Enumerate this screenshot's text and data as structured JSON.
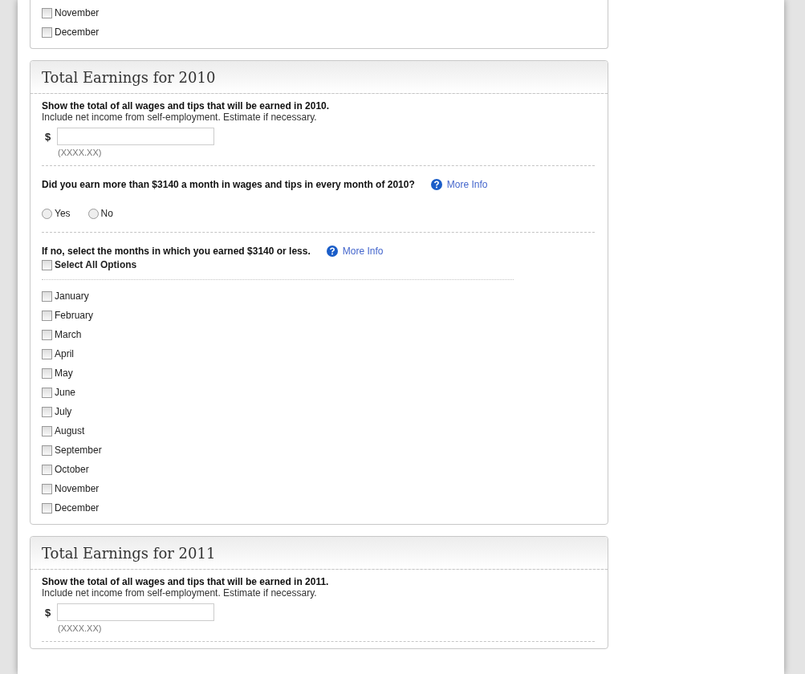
{
  "sections": [
    {
      "months": [
        {
          "label": "November",
          "checked": false
        },
        {
          "label": "December",
          "checked": false
        }
      ]
    },
    {
      "title": "Total Earnings for 2010",
      "prompt": "Show the total of all wages and tips that will be earned in 2010.",
      "hint": "Include net income from self-employment. Estimate if necessary.",
      "currency": "$",
      "format": "(XXXX.XX)",
      "question": "Did you earn more than $3140 a month in wages and tips in every month of 2010?",
      "question_link": "More Info",
      "options": [
        {
          "label": "Yes",
          "selected": false
        },
        {
          "label": "No",
          "selected": false
        }
      ],
      "months_prompt": "If no, select the months in which you earned $3140 or less.",
      "months_link": "More Info",
      "select_all": {
        "label": "Select All Options",
        "checked": false
      },
      "months": [
        {
          "label": "January",
          "checked": false
        },
        {
          "label": "February",
          "checked": false
        },
        {
          "label": "March",
          "checked": false
        },
        {
          "label": "April",
          "checked": false
        },
        {
          "label": "May",
          "checked": false
        },
        {
          "label": "June",
          "checked": false
        },
        {
          "label": "July",
          "checked": false
        },
        {
          "label": "August",
          "checked": false
        },
        {
          "label": "September",
          "checked": false
        },
        {
          "label": "October",
          "checked": false
        },
        {
          "label": "November",
          "checked": false
        },
        {
          "label": "December",
          "checked": false
        }
      ]
    },
    {
      "title": "Total Earnings for 2011",
      "prompt": "Show the total of all wages and tips that will be earned in 2011.",
      "hint": "Include net income from self-employment. Estimate if necessary.",
      "currency": "$",
      "format": "(XXXX.XX)"
    }
  ]
}
